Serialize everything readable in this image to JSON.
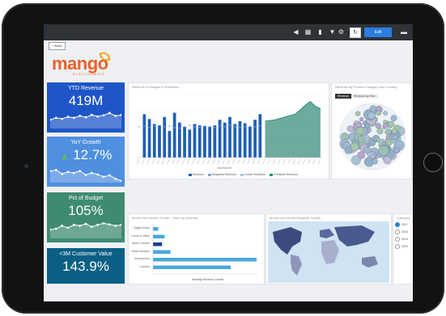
{
  "toolbar": {
    "refresh_symbol": "↻",
    "edit_label": "Edit",
    "icons": [
      "share-icon",
      "export-icon",
      "bookmark-icon",
      "filter-icon",
      "settings-icon",
      "more-icon"
    ]
  },
  "header": {
    "back_label": "< Back",
    "logo_text": "mango",
    "logo_subtext": "ELECTRONICS"
  },
  "kpis": [
    {
      "title": "YTD Revenue",
      "value": "419M",
      "color": "#1e56c8",
      "trend": [
        0.55,
        0.45,
        0.5,
        0.4,
        0.45,
        0.35,
        0.42,
        0.3,
        0.38,
        0.32,
        0.2,
        0.35,
        0.3
      ]
    },
    {
      "title": "YoY Growth",
      "value": "12.7%",
      "color": "#4f8fe0",
      "trend": [
        0.4,
        0.35,
        0.55,
        0.45,
        0.5,
        0.4,
        0.6,
        0.5,
        0.58,
        0.7,
        0.62,
        0.8,
        0.9
      ]
    },
    {
      "title": "Pct of Budget",
      "value": "105%",
      "color": "#3e8b72",
      "trend": [
        0.55,
        0.5,
        0.35,
        0.45,
        0.3,
        0.35,
        0.25,
        0.4,
        0.3,
        0.22,
        0.28,
        0.35,
        0.3
      ]
    },
    {
      "title": "<3M Customer Value",
      "value": "143.9%",
      "color": "#0b5f85",
      "trend": []
    }
  ],
  "revenue_panel": {
    "title": "Revenue vs Budget & Prediction",
    "axis_title": "Year/Month",
    "legend": [
      "Revenue",
      "Budgeted Revenue",
      "Linear Prediction",
      "Predicted Revenue"
    ],
    "colors": {
      "bar": "#1f5fb5",
      "budget": "#7aa6dc",
      "line": "#1e8f7a",
      "area": "#3f8e7f"
    }
  },
  "circles_panel": {
    "title": "Revenue by Product Category and Country",
    "tabs": [
      "Revenue",
      "Revenue by Year"
    ]
  },
  "growth_panel": {
    "title": "Month over Month Growth - Lines by Quantity",
    "axis_title": "Monthly Revenue Growth",
    "categories": [
      "Digital Music",
      "Home & Office",
      "Home Theater",
      "Smart Devices",
      "Accessories",
      "Camera"
    ],
    "light_color": "#4aa7dd",
    "dark_color": "#163f82"
  },
  "map_panel": {
    "title": "Month over Month Regional Growth"
  },
  "side_panel": {
    "title": "Category",
    "options": [
      "2017",
      "2018",
      "2019",
      "2020"
    ]
  },
  "chart_data": [
    {
      "type": "bar",
      "title": "Revenue vs Budget & Prediction",
      "xlabel": "Year/Month",
      "ylabel": "",
      "legend_position": "bottom",
      "series": [
        {
          "name": "Revenue",
          "values": [
            0,
            62,
            55,
            48,
            46,
            58,
            38,
            64,
            50,
            44,
            40,
            48,
            46,
            45,
            44,
            46,
            54,
            50,
            58,
            48,
            52,
            49,
            44,
            54,
            62
          ]
        },
        {
          "name": "Budgeted Revenue",
          "values": [
            44,
            45,
            43,
            45,
            46,
            44,
            45,
            43,
            42,
            44,
            46,
            44,
            43,
            45,
            44,
            43,
            45,
            44,
            46,
            44,
            43,
            44,
            45,
            44,
            45
          ]
        },
        {
          "name": "Predicted Revenue",
          "values": [
            52,
            53,
            54,
            56,
            58,
            60,
            62,
            68,
            75,
            80,
            73,
            70
          ]
        }
      ]
    },
    {
      "type": "bar",
      "title": "Month over Month Growth - Lines by Quantity",
      "xlabel": "Monthly Revenue Growth",
      "ylabel": "",
      "categories": [
        "Digital Music",
        "Home & Office",
        "Home Theater",
        "Smart Devices",
        "Accessories",
        "Camera"
      ],
      "values": [
        8,
        18,
        14,
        27,
        160,
        120
      ]
    }
  ]
}
